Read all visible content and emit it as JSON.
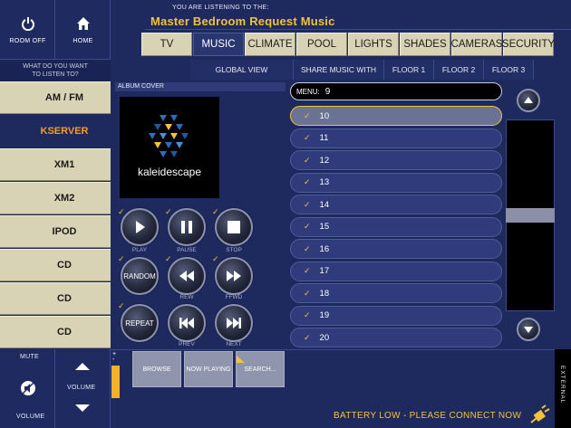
{
  "nav": {
    "room_off": "ROOM OFF",
    "home": "HOME"
  },
  "question": {
    "line1": "WHAT DO YOU WANT",
    "line2": "TO LISTEN TO?"
  },
  "listening": {
    "label": "YOU ARE LISTENING TO THE:",
    "title": "Master Bedroom Request Music"
  },
  "tabs": [
    "TV",
    "MUSIC",
    "CLIMATE",
    "POOL",
    "LIGHTS",
    "SHADES",
    "CAMERAS",
    "SECURITY"
  ],
  "active_tab": "MUSIC",
  "subtabs": [
    "GLOBAL VIEW",
    "SHARE MUSIC WITH",
    "FLOOR 1",
    "FLOOR 2",
    "FLOOR 3"
  ],
  "sources": [
    "AM / FM",
    "KSERVER",
    "XM1",
    "XM2",
    "IPOD",
    "CD",
    "CD",
    "CD"
  ],
  "active_source": "KSERVER",
  "album": {
    "label": "ALBUM COVER",
    "brand": "kaleidescape"
  },
  "transport": {
    "play": "PLAY",
    "pause": "PAUSE",
    "stop": "STOP",
    "random": "RANDOM",
    "rew": "REW",
    "ffwd": "FFWD",
    "repeat": "REPEAT",
    "prev": "PREV",
    "next": "NEXT"
  },
  "menu": {
    "label": "MENU:",
    "value": "9"
  },
  "list_items": [
    "10",
    "11",
    "12",
    "13",
    "14",
    "15",
    "16",
    "17",
    "18",
    "19",
    "20"
  ],
  "selected_item": "10",
  "scroll": {
    "position": 0.5
  },
  "bottom": {
    "mute": "MUTE",
    "volume_top": "VOLUME",
    "volume_mid": "VOLUME",
    "volume_bottom": "VOLUME",
    "browse": "BROWSE",
    "now_playing": "NOW PLAYING",
    "search": "SEARCH...",
    "battery": "BATTERY LOW - PLEASE CONNECT NOW",
    "external": "EXTERNAL",
    "pager_plus": "+",
    "pager_minus": "-"
  },
  "colors": {
    "accent": "#f3c236",
    "active_source": "#f39c28",
    "bg": "#1e2a5e",
    "tab": "#d8d3b4"
  }
}
